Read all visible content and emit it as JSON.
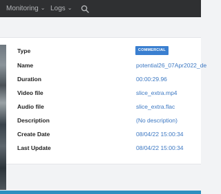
{
  "topnav": {
    "items": [
      {
        "label": "Monitoring"
      },
      {
        "label": "Logs"
      }
    ]
  },
  "details": {
    "type": {
      "label": "Type",
      "badge": "COMMERCIAL"
    },
    "name": {
      "label": "Name",
      "value": "potential26_07Apr2022_de"
    },
    "duration": {
      "label": "Duration",
      "value": "00:00:29.96"
    },
    "video_file": {
      "label": "Video file",
      "value": "slice_extra.mp4"
    },
    "audio_file": {
      "label": "Audio file",
      "value": "slice_extra.flac"
    },
    "description": {
      "label": "Description",
      "value": "(No description)"
    },
    "create_date": {
      "label": "Create Date",
      "value": "08/04/22 15:00:34"
    },
    "last_update": {
      "label": "Last Update",
      "value": "08/04/22 15:00:34"
    }
  },
  "colors": {
    "topbar": "#2f3032",
    "link": "#3b77c2",
    "badge": "#3a7fd0",
    "footer": "#2c8fc0"
  },
  "icons": [
    "chevron-down-icon",
    "search-icon"
  ]
}
